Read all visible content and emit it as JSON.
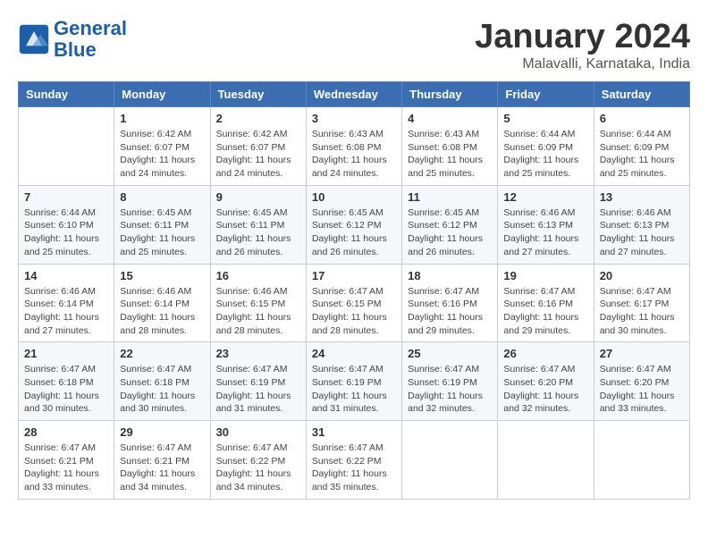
{
  "header": {
    "logo_line1": "General",
    "logo_line2": "Blue",
    "month_year": "January 2024",
    "location": "Malavalli, Karnataka, India"
  },
  "weekdays": [
    "Sunday",
    "Monday",
    "Tuesday",
    "Wednesday",
    "Thursday",
    "Friday",
    "Saturday"
  ],
  "weeks": [
    [
      {
        "day": "",
        "sunrise": "",
        "sunset": "",
        "daylight": ""
      },
      {
        "day": "1",
        "sunrise": "Sunrise: 6:42 AM",
        "sunset": "Sunset: 6:07 PM",
        "daylight": "Daylight: 11 hours and 24 minutes."
      },
      {
        "day": "2",
        "sunrise": "Sunrise: 6:42 AM",
        "sunset": "Sunset: 6:07 PM",
        "daylight": "Daylight: 11 hours and 24 minutes."
      },
      {
        "day": "3",
        "sunrise": "Sunrise: 6:43 AM",
        "sunset": "Sunset: 6:08 PM",
        "daylight": "Daylight: 11 hours and 24 minutes."
      },
      {
        "day": "4",
        "sunrise": "Sunrise: 6:43 AM",
        "sunset": "Sunset: 6:08 PM",
        "daylight": "Daylight: 11 hours and 25 minutes."
      },
      {
        "day": "5",
        "sunrise": "Sunrise: 6:44 AM",
        "sunset": "Sunset: 6:09 PM",
        "daylight": "Daylight: 11 hours and 25 minutes."
      },
      {
        "day": "6",
        "sunrise": "Sunrise: 6:44 AM",
        "sunset": "Sunset: 6:09 PM",
        "daylight": "Daylight: 11 hours and 25 minutes."
      }
    ],
    [
      {
        "day": "7",
        "sunrise": "Sunrise: 6:44 AM",
        "sunset": "Sunset: 6:10 PM",
        "daylight": "Daylight: 11 hours and 25 minutes."
      },
      {
        "day": "8",
        "sunrise": "Sunrise: 6:45 AM",
        "sunset": "Sunset: 6:11 PM",
        "daylight": "Daylight: 11 hours and 25 minutes."
      },
      {
        "day": "9",
        "sunrise": "Sunrise: 6:45 AM",
        "sunset": "Sunset: 6:11 PM",
        "daylight": "Daylight: 11 hours and 26 minutes."
      },
      {
        "day": "10",
        "sunrise": "Sunrise: 6:45 AM",
        "sunset": "Sunset: 6:12 PM",
        "daylight": "Daylight: 11 hours and 26 minutes."
      },
      {
        "day": "11",
        "sunrise": "Sunrise: 6:45 AM",
        "sunset": "Sunset: 6:12 PM",
        "daylight": "Daylight: 11 hours and 26 minutes."
      },
      {
        "day": "12",
        "sunrise": "Sunrise: 6:46 AM",
        "sunset": "Sunset: 6:13 PM",
        "daylight": "Daylight: 11 hours and 27 minutes."
      },
      {
        "day": "13",
        "sunrise": "Sunrise: 6:46 AM",
        "sunset": "Sunset: 6:13 PM",
        "daylight": "Daylight: 11 hours and 27 minutes."
      }
    ],
    [
      {
        "day": "14",
        "sunrise": "Sunrise: 6:46 AM",
        "sunset": "Sunset: 6:14 PM",
        "daylight": "Daylight: 11 hours and 27 minutes."
      },
      {
        "day": "15",
        "sunrise": "Sunrise: 6:46 AM",
        "sunset": "Sunset: 6:14 PM",
        "daylight": "Daylight: 11 hours and 28 minutes."
      },
      {
        "day": "16",
        "sunrise": "Sunrise: 6:46 AM",
        "sunset": "Sunset: 6:15 PM",
        "daylight": "Daylight: 11 hours and 28 minutes."
      },
      {
        "day": "17",
        "sunrise": "Sunrise: 6:47 AM",
        "sunset": "Sunset: 6:15 PM",
        "daylight": "Daylight: 11 hours and 28 minutes."
      },
      {
        "day": "18",
        "sunrise": "Sunrise: 6:47 AM",
        "sunset": "Sunset: 6:16 PM",
        "daylight": "Daylight: 11 hours and 29 minutes."
      },
      {
        "day": "19",
        "sunrise": "Sunrise: 6:47 AM",
        "sunset": "Sunset: 6:16 PM",
        "daylight": "Daylight: 11 hours and 29 minutes."
      },
      {
        "day": "20",
        "sunrise": "Sunrise: 6:47 AM",
        "sunset": "Sunset: 6:17 PM",
        "daylight": "Daylight: 11 hours and 30 minutes."
      }
    ],
    [
      {
        "day": "21",
        "sunrise": "Sunrise: 6:47 AM",
        "sunset": "Sunset: 6:18 PM",
        "daylight": "Daylight: 11 hours and 30 minutes."
      },
      {
        "day": "22",
        "sunrise": "Sunrise: 6:47 AM",
        "sunset": "Sunset: 6:18 PM",
        "daylight": "Daylight: 11 hours and 30 minutes."
      },
      {
        "day": "23",
        "sunrise": "Sunrise: 6:47 AM",
        "sunset": "Sunset: 6:19 PM",
        "daylight": "Daylight: 11 hours and 31 minutes."
      },
      {
        "day": "24",
        "sunrise": "Sunrise: 6:47 AM",
        "sunset": "Sunset: 6:19 PM",
        "daylight": "Daylight: 11 hours and 31 minutes."
      },
      {
        "day": "25",
        "sunrise": "Sunrise: 6:47 AM",
        "sunset": "Sunset: 6:19 PM",
        "daylight": "Daylight: 11 hours and 32 minutes."
      },
      {
        "day": "26",
        "sunrise": "Sunrise: 6:47 AM",
        "sunset": "Sunset: 6:20 PM",
        "daylight": "Daylight: 11 hours and 32 minutes."
      },
      {
        "day": "27",
        "sunrise": "Sunrise: 6:47 AM",
        "sunset": "Sunset: 6:20 PM",
        "daylight": "Daylight: 11 hours and 33 minutes."
      }
    ],
    [
      {
        "day": "28",
        "sunrise": "Sunrise: 6:47 AM",
        "sunset": "Sunset: 6:21 PM",
        "daylight": "Daylight: 11 hours and 33 minutes."
      },
      {
        "day": "29",
        "sunrise": "Sunrise: 6:47 AM",
        "sunset": "Sunset: 6:21 PM",
        "daylight": "Daylight: 11 hours and 34 minutes."
      },
      {
        "day": "30",
        "sunrise": "Sunrise: 6:47 AM",
        "sunset": "Sunset: 6:22 PM",
        "daylight": "Daylight: 11 hours and 34 minutes."
      },
      {
        "day": "31",
        "sunrise": "Sunrise: 6:47 AM",
        "sunset": "Sunset: 6:22 PM",
        "daylight": "Daylight: 11 hours and 35 minutes."
      },
      {
        "day": "",
        "sunrise": "",
        "sunset": "",
        "daylight": ""
      },
      {
        "day": "",
        "sunrise": "",
        "sunset": "",
        "daylight": ""
      },
      {
        "day": "",
        "sunrise": "",
        "sunset": "",
        "daylight": ""
      }
    ]
  ]
}
